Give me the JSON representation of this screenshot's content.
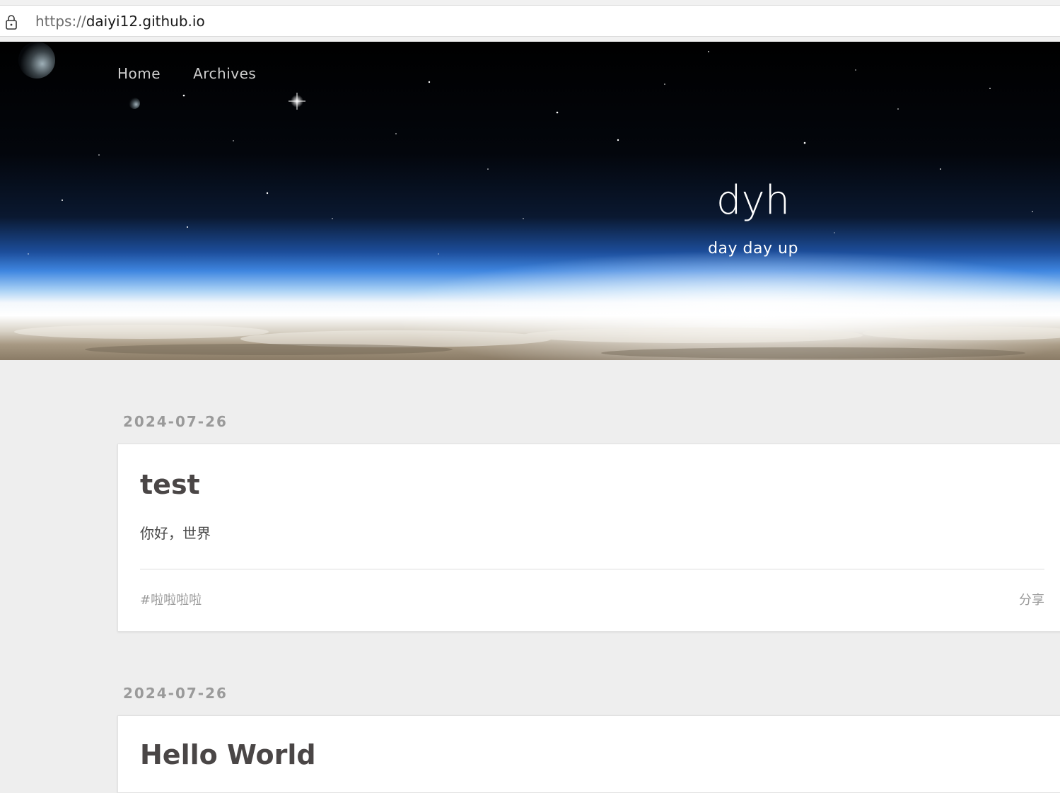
{
  "browser": {
    "url_scheme": "https://",
    "url_host": "daiyi12.github.io"
  },
  "nav": {
    "items": [
      {
        "label": "Home"
      },
      {
        "label": "Archives"
      }
    ]
  },
  "header": {
    "title": "dyh",
    "subtitle": "day day up"
  },
  "posts": [
    {
      "date": "2024-07-26",
      "title": "test",
      "excerpt": "你好，世界",
      "tag": "#啦啦啦啦",
      "share_label": "分享"
    },
    {
      "date": "2024-07-26",
      "title": "Hello World"
    }
  ],
  "icons": {
    "lock": "lock-icon"
  },
  "colors": {
    "page_background": "#eeeeee",
    "card_background": "#ffffff",
    "title_text": "#4a4646",
    "muted_text": "#9a9a9a"
  }
}
